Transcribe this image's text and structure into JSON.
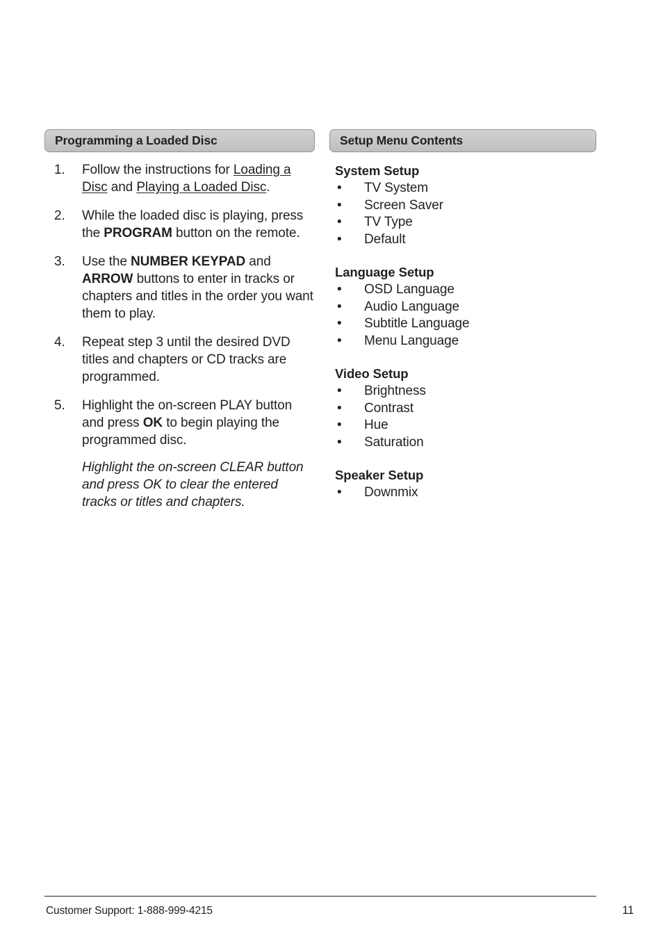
{
  "left_column": {
    "header": "Programming a Loaded Disc",
    "steps": [
      {
        "number": "1.",
        "segments": [
          {
            "text": "Follow the instructions for ",
            "style": "normal"
          },
          {
            "text": "Loading a Disc",
            "style": "underline"
          },
          {
            "text": " and ",
            "style": "normal"
          },
          {
            "text": "Playing a Loaded Disc",
            "style": "underline"
          },
          {
            "text": ".",
            "style": "normal"
          }
        ]
      },
      {
        "number": "2.",
        "segments": [
          {
            "text": "While the loaded disc is playing, press the ",
            "style": "normal"
          },
          {
            "text": "PROGRAM",
            "style": "bold"
          },
          {
            "text": " button on the remote.",
            "style": "normal"
          }
        ]
      },
      {
        "number": "3.",
        "segments": [
          {
            "text": "Use the ",
            "style": "normal"
          },
          {
            "text": "NUMBER KEYPAD",
            "style": "bold"
          },
          {
            "text": " and ",
            "style": "normal"
          },
          {
            "text": "ARROW",
            "style": "bold"
          },
          {
            "text": " buttons to enter in tracks or chapters and titles in the order you want them to play.",
            "style": "normal"
          }
        ]
      },
      {
        "number": "4.",
        "segments": [
          {
            "text": "Repeat step 3 until the desired DVD titles and chapters or CD tracks are programmed.",
            "style": "normal"
          }
        ]
      },
      {
        "number": "5.",
        "segments": [
          {
            "text": "Highlight the on-screen PLAY button and press ",
            "style": "normal"
          },
          {
            "text": "OK",
            "style": "bold"
          },
          {
            "text": " to begin playing the programmed disc.",
            "style": "normal"
          }
        ],
        "note": "Highlight the on-screen CLEAR button and press OK to clear the entered tracks or titles and chapters."
      }
    ]
  },
  "right_column": {
    "header": "Setup Menu Contents",
    "groups": [
      {
        "title": "System Setup",
        "items": [
          "TV System",
          "Screen Saver",
          "TV Type",
          "Default"
        ]
      },
      {
        "title": "Language Setup",
        "items": [
          "OSD Language",
          "Audio Language",
          "Subtitle Language",
          "Menu Language"
        ]
      },
      {
        "title": "Video Setup",
        "items": [
          "Brightness",
          "Contrast",
          "Hue",
          "Saturation"
        ]
      },
      {
        "title": "Speaker Setup",
        "items": [
          "Downmix"
        ]
      }
    ],
    "bullet_glyph": "•"
  },
  "footer": {
    "support_text": "Customer Support: 1-888-999-4215",
    "page_number": "11"
  },
  "colors": {
    "text": "#231f20",
    "bar_fill_top": "#d2d2d2",
    "bar_fill_bottom": "#bfbfbf",
    "bar_border": "#939393"
  }
}
